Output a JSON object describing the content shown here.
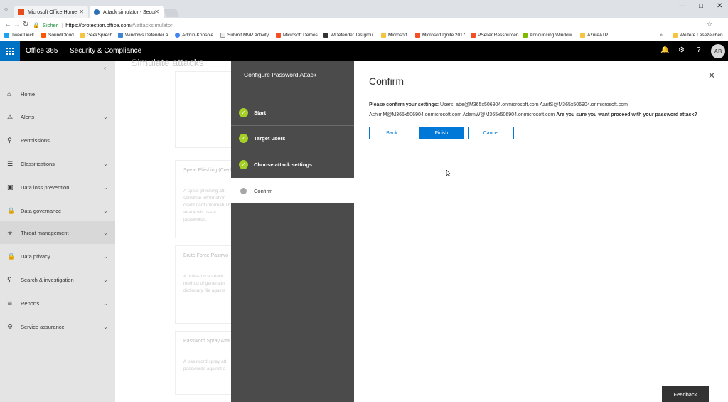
{
  "browser": {
    "tabs": [
      {
        "title": "Microsoft Office Home",
        "icon": "office-icon"
      },
      {
        "title": "Attack simulator - Secur",
        "icon": "shield-icon"
      }
    ],
    "address": {
      "secure_label": "Sicher",
      "host": "https://protection.office.com",
      "path": "/#/attacksimulator"
    },
    "bookmarks": [
      "TweetDeck",
      "SoundCloud",
      "GeekSprech",
      "Windows Defender A",
      "Admin-Konsole",
      "Submit MVP Activity",
      "Microsoft Demos",
      "WDefender Testgrou",
      "Microsoft",
      "Microsoft Ignite 2017",
      "PSeller Ressourcen",
      "Announcing Window",
      "AzureATP"
    ],
    "more_bookmarks": "»",
    "other_bookmarks": "Weitere Lesezeichen"
  },
  "header": {
    "brand": "Office 365",
    "suite": "Security & Compliance",
    "avatar_initials": "AB"
  },
  "nav": {
    "items": [
      {
        "label": "Home",
        "icon": "home-icon",
        "chevron": false
      },
      {
        "label": "Alerts",
        "icon": "alert-icon",
        "chevron": true
      },
      {
        "label": "Permissions",
        "icon": "permissions-icon",
        "chevron": false
      },
      {
        "label": "Classifications",
        "icon": "classifications-icon",
        "chevron": true
      },
      {
        "label": "Data loss prevention",
        "icon": "dlp-icon",
        "chevron": true
      },
      {
        "label": "Data governance",
        "icon": "lock-icon",
        "chevron": true
      },
      {
        "label": "Threat management",
        "icon": "biohazard-icon",
        "chevron": true
      },
      {
        "label": "Data privacy",
        "icon": "privacy-lock-icon",
        "chevron": true
      },
      {
        "label": "Search & investigation",
        "icon": "search-icon",
        "chevron": true
      },
      {
        "label": "Reports",
        "icon": "reports-icon",
        "chevron": true
      },
      {
        "label": "Service assurance",
        "icon": "service-icon",
        "chevron": true
      }
    ]
  },
  "background": {
    "title": "Simulate attacks",
    "cards": [
      {
        "title": "Spear Phishing (Cred",
        "desc": "A spear-phishing att sensitive information credit card informati This attack will use a passwords."
      },
      {
        "title": "Brute Force Passwo",
        "desc": "A brute-force attack method of generatin dictionary file agains"
      },
      {
        "title": "Password Spray Atta",
        "desc": "A password spray att passwords against a"
      }
    ]
  },
  "wizard": {
    "title": "Configure Password Attack",
    "steps": [
      {
        "label": "Start",
        "status": "done"
      },
      {
        "label": "Target users",
        "status": "done"
      },
      {
        "label": "Choose attack settings",
        "status": "done"
      },
      {
        "label": "Confirm",
        "status": "current"
      }
    ],
    "confirm": {
      "heading": "Confirm",
      "prompt": "Please confirm your settings:",
      "users_prefix": "Users:",
      "users": "abe@M365x506904.onmicrosoft.com AarifS@M365x506904.onmicrosoft.com AchimM@M365x506904.onmicrosoft.com AdamW@M365x506904.onmicrosoft.com",
      "question": "Are you sure you want proceed with your password attack?",
      "back_label": "Back",
      "finish_label": "Finish",
      "cancel_label": "Cancel"
    }
  },
  "feedback_label": "Feedback",
  "colors": {
    "accent": "#0078d7",
    "waffle": "#0072c6",
    "step_done": "#a4cf27",
    "wizard_panel": "#4b4b4b"
  }
}
